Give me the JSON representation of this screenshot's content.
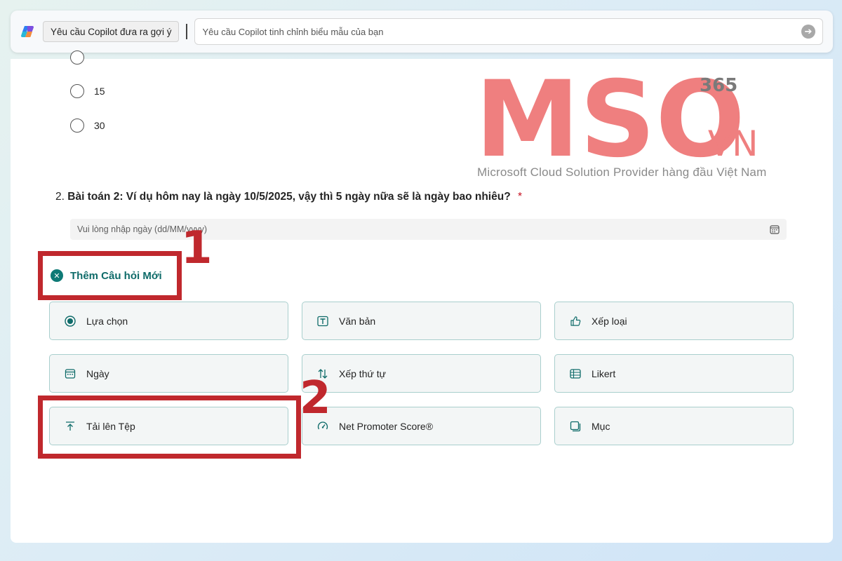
{
  "copilot": {
    "suggest_button": "Yêu cầu Copilot đưa ra gợi ý",
    "input_placeholder": "Yêu cầu Copilot tinh chỉnh biểu mẫu của bạn"
  },
  "watermark": {
    "brand": "MSO",
    "suffix": ".VN",
    "badge": "365",
    "tagline": "Microsoft Cloud Solution Provider hàng đầu Việt Nam"
  },
  "options_prev": [
    "15",
    "30"
  ],
  "question": {
    "number": "2.",
    "title": "Bài toán 2: Ví dụ hôm nay là ngày 10/5/2025, vậy thì 5 ngày nữa sẽ là ngày bao nhiêu?",
    "required_mark": "*",
    "date_placeholder": "Vui lòng nhập ngày (dd/MM/yyyy)"
  },
  "add_question": {
    "label": "Thêm Câu hỏi Mới"
  },
  "annotations": {
    "step1": "1",
    "step2": "2",
    "color": "#c0282d"
  },
  "question_types": [
    {
      "label": "Lựa chọn",
      "icon": "radio-choice-icon"
    },
    {
      "label": "Văn bản",
      "icon": "text-box-icon"
    },
    {
      "label": "Xếp loại",
      "icon": "thumb-up-icon"
    },
    {
      "label": "Ngày",
      "icon": "calendar-icon"
    },
    {
      "label": "Xếp thứ tự",
      "icon": "sort-arrows-icon"
    },
    {
      "label": "Likert",
      "icon": "likert-grid-icon"
    },
    {
      "label": "Tải lên Tệp",
      "icon": "upload-icon"
    },
    {
      "label": "Net Promoter Score®",
      "icon": "gauge-icon"
    },
    {
      "label": "Mục",
      "icon": "section-icon"
    }
  ],
  "colors": {
    "accent": "#0e6b69",
    "option_border": "#a9cfcd",
    "watermark": "#ef7f7f"
  }
}
